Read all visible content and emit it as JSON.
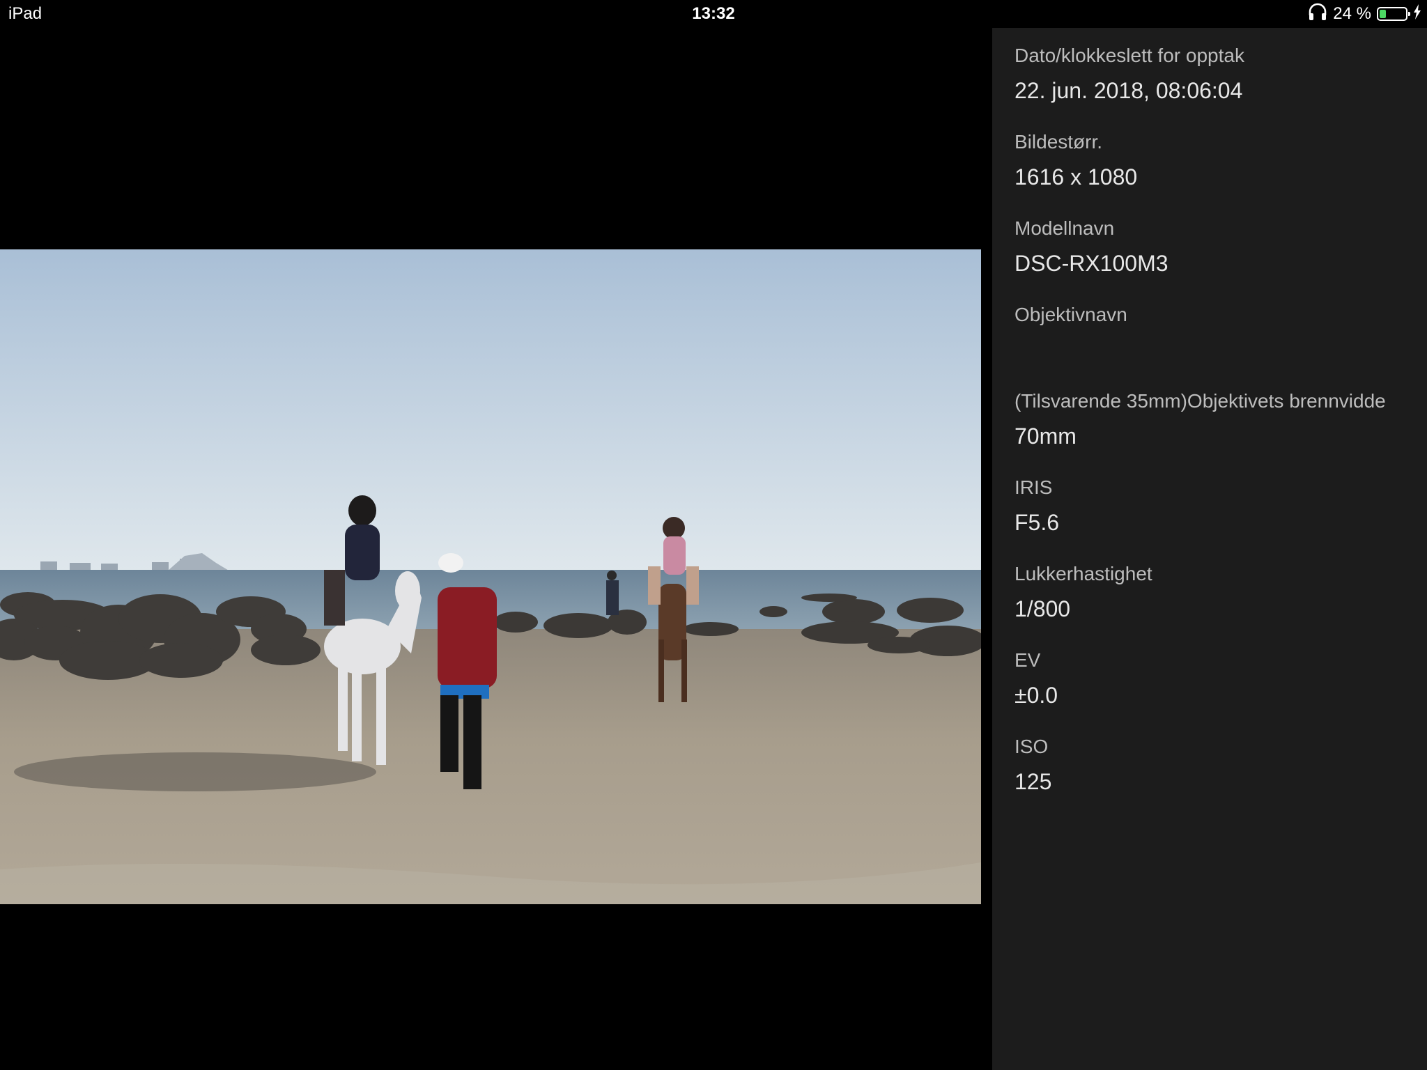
{
  "status_bar": {
    "device": "iPad",
    "time": "13:32",
    "battery_text": "24 %",
    "battery_level": 0.24,
    "icons": [
      "headphones-icon",
      "battery-icon",
      "charging-bolt-icon"
    ]
  },
  "photo": {
    "colors": {
      "sky_top": "#a9bfd6",
      "sky_bottom": "#dde6ec",
      "sea": "#5f7a90",
      "sand": "#a49a8a"
    }
  },
  "info": {
    "items": [
      {
        "label": "Dato/klokkeslett for opptak",
        "value": "22. jun. 2018, 08:06:04"
      },
      {
        "label": "Bildestørr.",
        "value": "1616 x 1080"
      },
      {
        "label": "Modellnavn",
        "value": "DSC-RX100M3"
      },
      {
        "label": "Objektivnavn",
        "value": ""
      },
      {
        "label": "(Tilsvarende 35mm)Objektivets brennvidde",
        "value": "70mm"
      },
      {
        "label": "IRIS",
        "value": "F5.6"
      },
      {
        "label": "Lukkerhastighet",
        "value": "1/800"
      },
      {
        "label": "EV",
        "value": "±0.0"
      },
      {
        "label": "ISO",
        "value": "125"
      }
    ]
  }
}
